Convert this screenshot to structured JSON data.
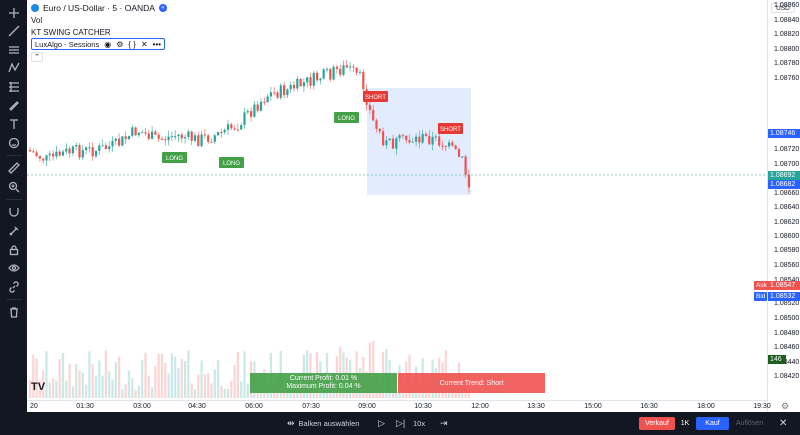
{
  "symbol": {
    "title": "Euro / US-Dollar · 5 · OANDA",
    "currency": "USD",
    "volume_label": "Vol",
    "indicator_1": "KT SWING CATCHER",
    "indicator_2": "LuxAlgo - Sessions"
  },
  "price_axis": {
    "ticks": [
      "1.08860",
      "1.08840",
      "1.08820",
      "1.08800",
      "1.08780",
      "1.08760",
      "1.08720",
      "1.08700",
      "1.08680",
      "1.08660",
      "1.08640",
      "1.08620",
      "1.08600",
      "1.08580",
      "1.08560",
      "1.08540",
      "1.08520",
      "1.08500",
      "1.08480",
      "1.08460",
      "1.08440",
      "1.08420"
    ],
    "tags": {
      "level_1": "1.08746",
      "last_price": "1.08692",
      "level_2": "1.08682",
      "ask_label": "Ask",
      "ask": "1.08547",
      "bid_label": "Bid",
      "bid": "1.08532",
      "volume": "146"
    }
  },
  "time_axis": {
    "ticks": [
      "20",
      "01:30",
      "03:00",
      "04:30",
      "06:00",
      "07:30",
      "09:00",
      "10:30",
      "12:00",
      "13:30",
      "15:00",
      "16:30",
      "18:00",
      "19:30"
    ]
  },
  "signals": [
    "LONG",
    "LONG",
    "LONG",
    "SHORT",
    "SHORT"
  ],
  "panels": {
    "profit_current": "Current Profit:  0.01 %",
    "profit_max": "Maximum Profit: 0.04 %",
    "trend": "Current Trend:  Short"
  },
  "replay": {
    "select_bar": "Balken auswählen",
    "speed": "10x",
    "sell": "Verkauf",
    "qty": "1K",
    "buy": "Kauf",
    "resolve": "Auflösen"
  },
  "colors": {
    "up": "#26a69a",
    "down": "#ef5350",
    "long": "#43a047",
    "short": "#e53935",
    "accent": "#2962ff",
    "toolbar": "#131722"
  },
  "logo": "TV"
}
